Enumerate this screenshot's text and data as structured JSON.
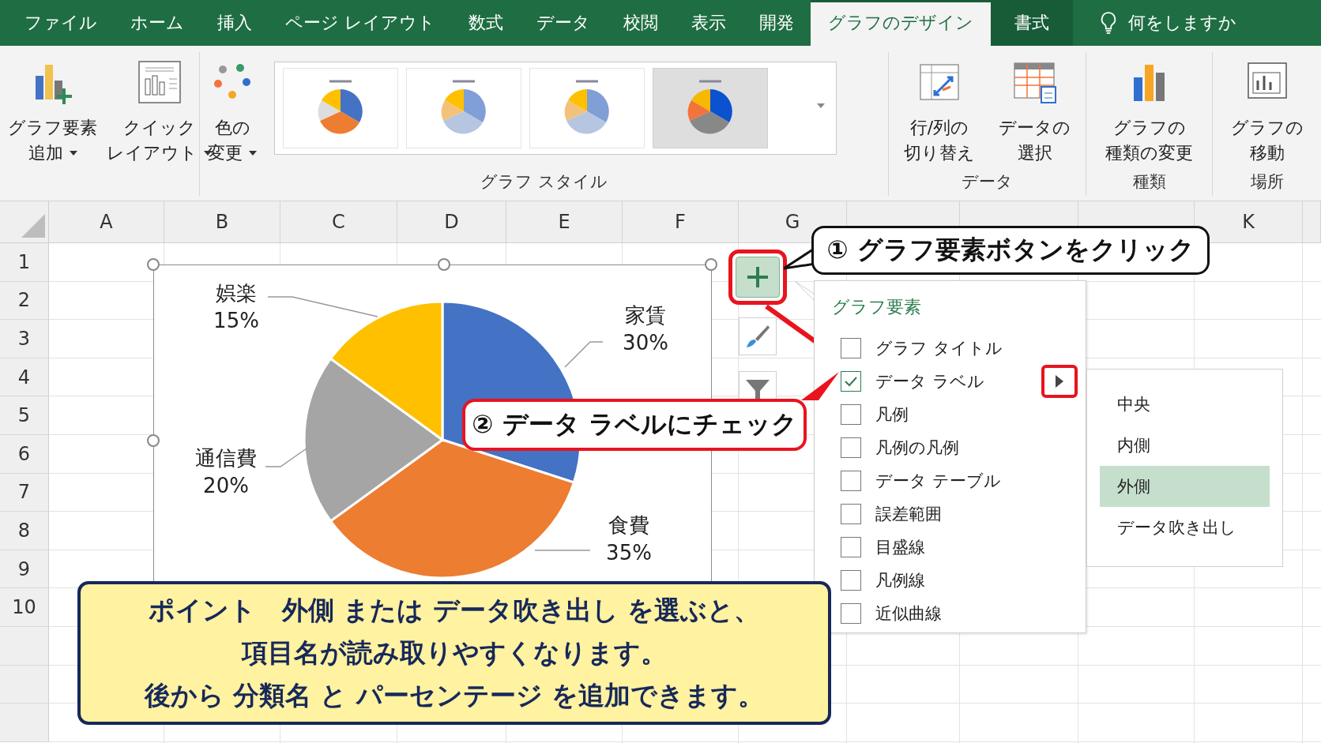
{
  "tabs": [
    {
      "label": "ファイル",
      "selected": false,
      "contextual": false
    },
    {
      "label": "ホーム",
      "selected": false,
      "contextual": false
    },
    {
      "label": "挿入",
      "selected": false,
      "contextual": false
    },
    {
      "label": "ページ レイアウト",
      "selected": false,
      "contextual": false
    },
    {
      "label": "数式",
      "selected": false,
      "contextual": false
    },
    {
      "label": "データ",
      "selected": false,
      "contextual": false
    },
    {
      "label": "校閲",
      "selected": false,
      "contextual": false
    },
    {
      "label": "表示",
      "selected": false,
      "contextual": false
    },
    {
      "label": "開発",
      "selected": false,
      "contextual": false
    },
    {
      "label": "グラフのデザイン",
      "selected": true,
      "contextual": true
    },
    {
      "label": "書式",
      "selected": false,
      "contextual": true
    }
  ],
  "tell_me": "何をしますか",
  "ribbon": {
    "groups": [
      {
        "buttons": [
          {
            "kind": "add-element",
            "lines": [
              "グラフ要素",
              "追加"
            ],
            "dropdown": true
          },
          {
            "kind": "quick-layout",
            "lines": [
              "クイック",
              "レイアウト"
            ],
            "dropdown": true
          }
        ]
      },
      {
        "label": "グラフ スタイル",
        "buttons": [
          {
            "kind": "colors",
            "lines": [
              "色の",
              "変更"
            ],
            "dropdown": true
          }
        ],
        "styles": [
          {
            "selected": false
          },
          {
            "selected": false
          },
          {
            "selected": false
          },
          {
            "selected": true
          }
        ]
      },
      {
        "label": "データ",
        "buttons": [
          {
            "kind": "switch-row-col",
            "lines": [
              "行/列の",
              "切り替え"
            ],
            "dropdown": false
          },
          {
            "kind": "select-data",
            "lines": [
              "データの",
              "選択"
            ],
            "dropdown": false
          }
        ]
      },
      {
        "label": "種類",
        "buttons": [
          {
            "kind": "change-type",
            "lines": [
              "グラフの",
              "種類の変更"
            ],
            "dropdown": false
          }
        ]
      },
      {
        "label": "場所",
        "buttons": [
          {
            "kind": "move-chart",
            "lines": [
              "グラフの",
              "移動"
            ],
            "dropdown": false
          }
        ]
      }
    ]
  },
  "columns": [
    "A",
    "B",
    "C",
    "D",
    "E",
    "F",
    "G",
    "K"
  ],
  "rows": [
    "1",
    "2",
    "3",
    "4",
    "5",
    "6",
    "7",
    "8",
    "9",
    "10"
  ],
  "chart": {
    "chart_data": {
      "type": "pie",
      "categories": [
        "家賃",
        "食費",
        "通信費",
        "娯楽"
      ],
      "values": [
        30,
        35,
        20,
        15
      ],
      "colors": [
        "#4472c4",
        "#ed7d31",
        "#a5a5a5",
        "#ffc000"
      ],
      "value_labels": [
        "30%",
        "35%",
        "20%",
        "15%"
      ]
    }
  },
  "chart_tools": [
    {
      "kind": "elements",
      "highlighted": true
    },
    {
      "kind": "styles",
      "highlighted": false
    },
    {
      "kind": "filter",
      "highlighted": false
    }
  ],
  "elements_menu": {
    "title": "グラフ要素",
    "items": [
      {
        "label": "グラフ タイトル",
        "checked": false
      },
      {
        "label": "データ ラベル",
        "checked": true,
        "submenu_button": {
          "highlighted": true
        }
      },
      {
        "label": "凡例",
        "checked": false
      },
      {
        "label": "凡例の凡例",
        "checked": false
      },
      {
        "label": "データ テーブル",
        "checked": false
      },
      {
        "label": "誤差範囲",
        "checked": false
      },
      {
        "label": "目盛線",
        "checked": false
      },
      {
        "label": "凡例線",
        "checked": false
      },
      {
        "label": "近似曲線",
        "checked": false
      }
    ]
  },
  "submenu": {
    "items": [
      {
        "label": "中央",
        "selected": false
      },
      {
        "label": "内側",
        "selected": false
      },
      {
        "label": "外側",
        "selected": true
      },
      {
        "label": "データ吹き出し",
        "selected": false
      }
    ]
  },
  "callouts": [
    {
      "kind": "step",
      "text": "① グラフ要素ボタンをクリック"
    },
    {
      "kind": "alert",
      "text": "② データ ラベルにチェック"
    }
  ],
  "note": {
    "lines": [
      "ポイント　外側 または データ吹き出し を選ぶと、",
      "項目名が読み取りやすくなります。",
      "後から 分類名 と パーセンテージ を追加できます。"
    ]
  }
}
